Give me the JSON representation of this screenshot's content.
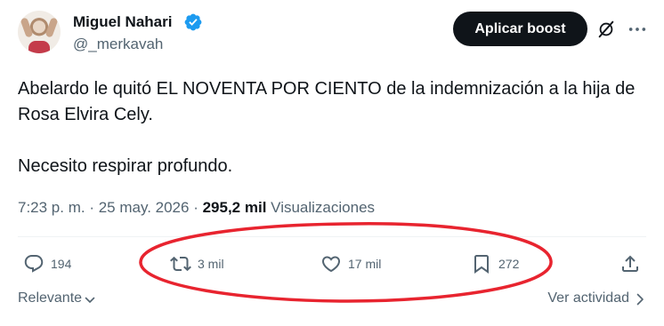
{
  "author": {
    "name": "Miguel Nahari",
    "handle": "@_merkavah",
    "verified": true
  },
  "header": {
    "boost_label": "Aplicar boost",
    "icons": [
      "grok-icon",
      "more-options-icon"
    ]
  },
  "tweet": {
    "paragraphs": [
      "Abelardo le quitó EL NOVENTA POR CIENTO de la indemnización a la hija de Rosa Elvira Cely.",
      "Necesito respirar profundo."
    ]
  },
  "meta": {
    "time": "7:23 p. m.",
    "separator": " · ",
    "date": "25 may. 2026",
    "separator2": " · ",
    "views_count": "295,2 mil",
    "views_label": "Visualizaciones"
  },
  "actions": {
    "reply_count": "194",
    "retweet_count": "3 mil",
    "like_count": "17 mil",
    "bookmark_count": "272"
  },
  "footer": {
    "sort_label": "Relevante",
    "activity_label": "Ver actividad"
  },
  "colors": {
    "text": "#0f1419",
    "secondary": "#536471",
    "verified": "#1d9bf0",
    "annotation": "#e8242f"
  }
}
